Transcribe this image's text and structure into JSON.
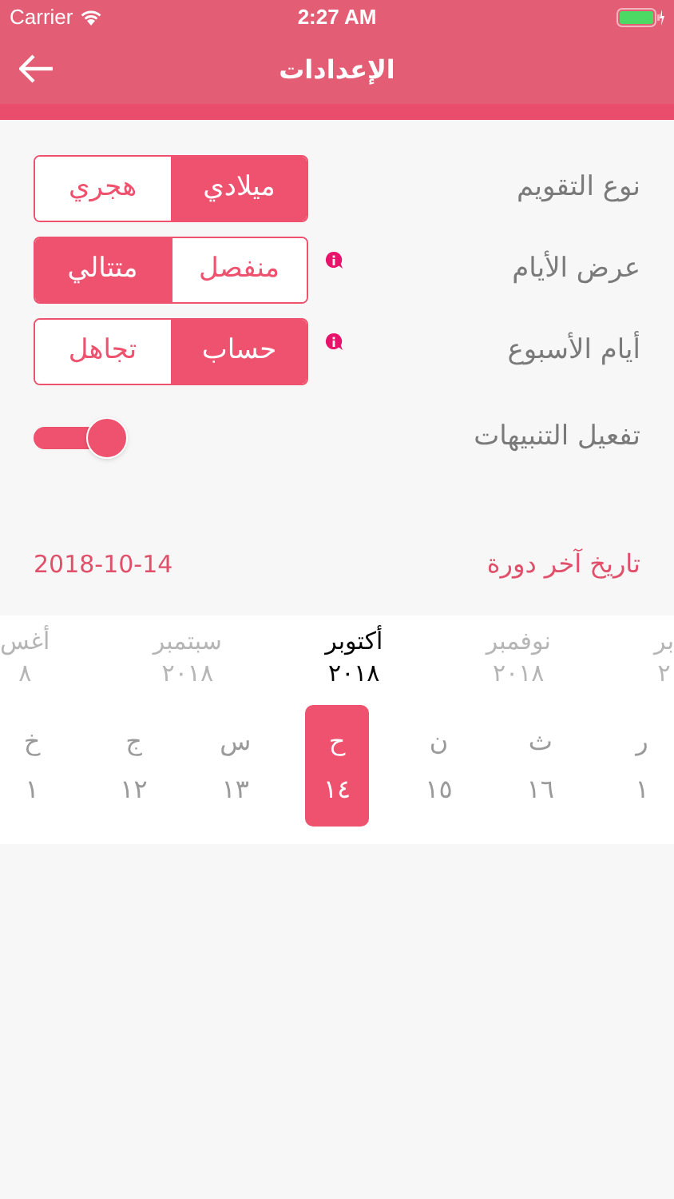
{
  "status_bar": {
    "carrier": "Carrier",
    "time": "2:27 AM"
  },
  "nav": {
    "title": "الإعدادات"
  },
  "settings": [
    {
      "kind": "segmented",
      "label": "نوع التقويم",
      "info": false,
      "options": [
        {
          "label": "ميلادي",
          "selected": true
        },
        {
          "label": "هجري",
          "selected": false
        }
      ]
    },
    {
      "kind": "segmented",
      "label": "عرض الأيام",
      "info": true,
      "options": [
        {
          "label": "منفصل",
          "selected": false
        },
        {
          "label": "متتالي",
          "selected": true
        }
      ]
    },
    {
      "kind": "segmented",
      "label": "أيام الأسبوع",
      "info": true,
      "options": [
        {
          "label": "حساب",
          "selected": true
        },
        {
          "label": "تجاهل",
          "selected": false
        }
      ]
    },
    {
      "kind": "toggle",
      "label": "تفعيل التنبيهات",
      "on": true
    }
  ],
  "last_cycle": {
    "label": "تاريخ آخر دورة",
    "value": "2018-10-14"
  },
  "months": [
    {
      "name": "بر",
      "year": "٢",
      "selected": false
    },
    {
      "name": "نوفمبر",
      "year": "٢٠١٨",
      "selected": false
    },
    {
      "name": "أكتوبر",
      "year": "٢٠١٨",
      "selected": true
    },
    {
      "name": "سبتمبر",
      "year": "٢٠١٨",
      "selected": false
    },
    {
      "name": "أغس",
      "year": "٨",
      "selected": false
    }
  ],
  "days": [
    {
      "letter": "ر",
      "number": "١",
      "selected": false
    },
    {
      "letter": "ث",
      "number": "١٦",
      "selected": false
    },
    {
      "letter": "ن",
      "number": "١٥",
      "selected": false
    },
    {
      "letter": "ح",
      "number": "١٤",
      "selected": true
    },
    {
      "letter": "س",
      "number": "١٣",
      "selected": false
    },
    {
      "letter": "ج",
      "number": "١٢",
      "selected": false
    },
    {
      "letter": "خ",
      "number": "١",
      "selected": false
    }
  ]
}
